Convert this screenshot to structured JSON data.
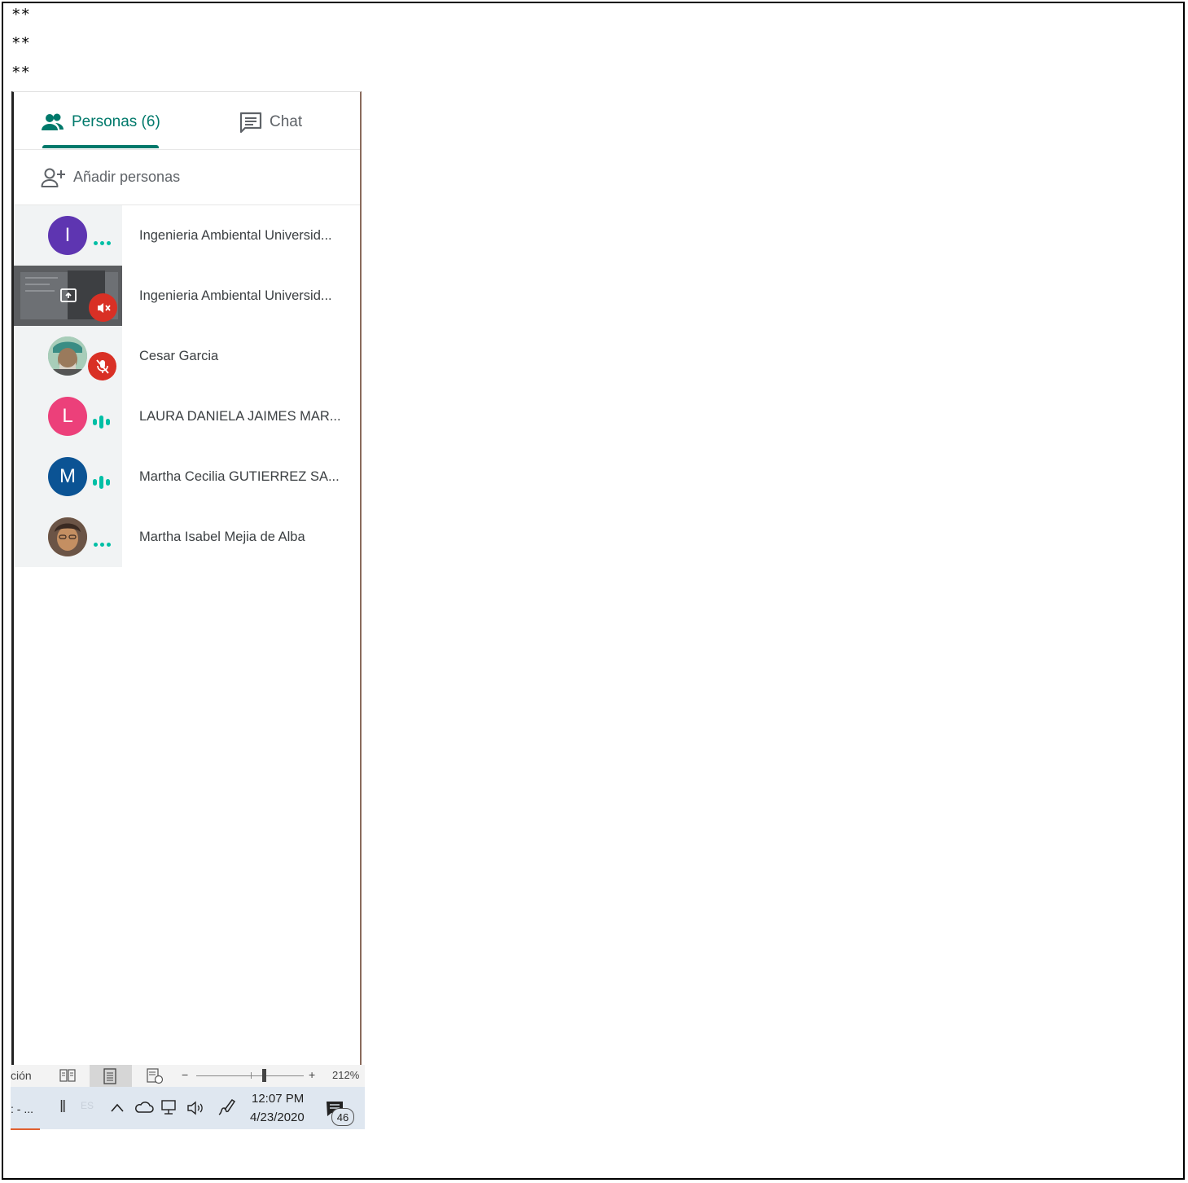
{
  "document": {
    "lines": [
      "**",
      "**",
      "**"
    ]
  },
  "meet": {
    "tabs": {
      "people_label": "Personas (6)",
      "chat_label": "Chat"
    },
    "add_people_label": "Añadir personas",
    "participants": [
      {
        "name": "Ingenieria Ambiental Universid...",
        "initial": "I",
        "color": "#5e35b1",
        "indicator": "dots"
      },
      {
        "name": "Ingenieria Ambiental Universid...",
        "initial": "",
        "color": "",
        "indicator": "presenting-muted"
      },
      {
        "name": "Cesar Garcia",
        "initial": "",
        "color": "",
        "indicator": "muted"
      },
      {
        "name": "LAURA DANIELA JAIMES MAR...",
        "initial": "L",
        "color": "#ec407a",
        "indicator": "talking"
      },
      {
        "name": "Martha Cecilia GUTIERREZ SA...",
        "initial": "M",
        "color": "#0b5394",
        "indicator": "talking"
      },
      {
        "name": "Martha Isabel Mejia de Alba",
        "initial": "",
        "color": "",
        "indicator": "dots"
      }
    ],
    "accent_color": "#00796b"
  },
  "word_status": {
    "left_text": "ción",
    "zoom_minus": "−",
    "zoom_plus": "+",
    "zoom_level": "212%"
  },
  "taskbar": {
    "left_text": ": - ...",
    "lang": "ES",
    "time": "12:07 PM",
    "date": "4/23/2020",
    "notifications": "46"
  }
}
